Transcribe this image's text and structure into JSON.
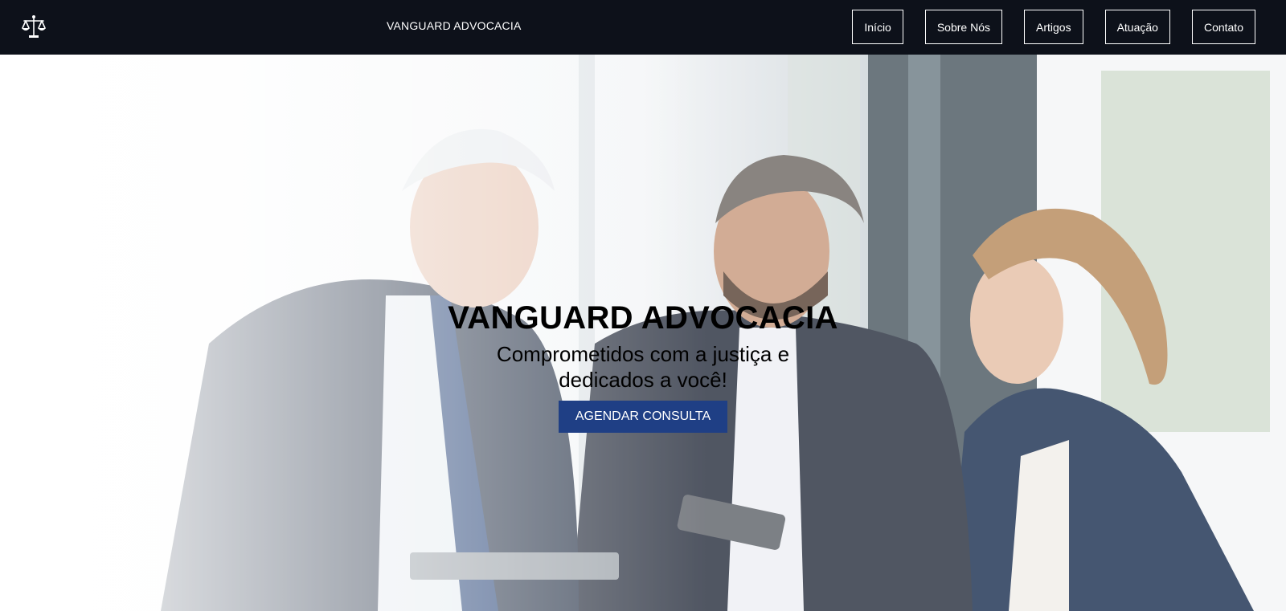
{
  "header": {
    "logo_icon": "scales-of-justice-icon",
    "brand": "VANGUARD ADVOCACIA",
    "nav": [
      {
        "label": "Início"
      },
      {
        "label": "Sobre Nós"
      },
      {
        "label": "Artigos"
      },
      {
        "label": "Atuação"
      },
      {
        "label": "Contato"
      }
    ],
    "background": "#0d111a"
  },
  "hero": {
    "title": "VANGUARD ADVOCACIA",
    "subtitle": "Comprometidos com a justiça e dedicados a você!",
    "cta_label": "AGENDAR CONSULTA",
    "cta_color": "#1f3f85"
  }
}
